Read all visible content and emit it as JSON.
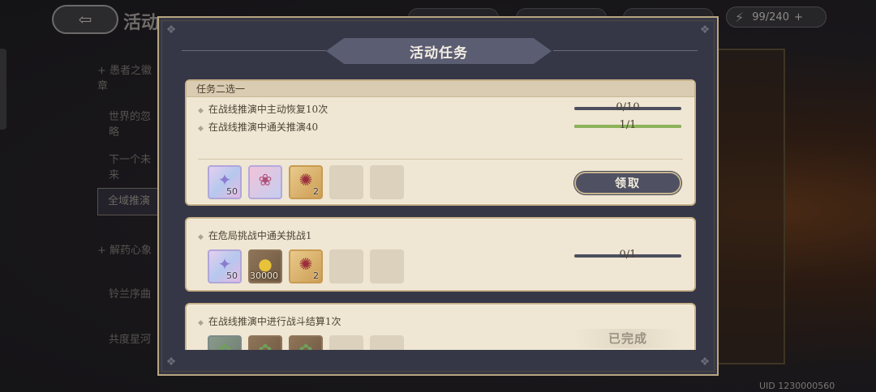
{
  "background": {
    "title": "活动",
    "energy": "99/240",
    "energy_plus": "+",
    "sidebar": [
      "+ 愚者之徽章",
      "世界的忽略",
      "下一个未来",
      "全域推演",
      "+ 解药心象",
      "铃兰序曲",
      "共度星河"
    ],
    "active_sidebar_index": 3,
    "uid": "UID 1230000560"
  },
  "dialog": {
    "title": "活动任务",
    "cards": [
      {
        "header": "任务二选一",
        "tasks": [
          {
            "label": "在战线推演中主动恢复10次",
            "progress_text": "0/10",
            "progress": 0.0
          },
          {
            "label": "在战线推演中通关推演40",
            "progress_text": "1/1",
            "progress": 1.0
          }
        ],
        "rewards": [
          {
            "icon": "star-shard-icon",
            "count": "50",
            "style": "purple"
          },
          {
            "icon": "pink-creature-icon",
            "count": "",
            "style": "pink"
          },
          {
            "icon": "red-crab-icon",
            "count": "2",
            "style": "gold"
          }
        ],
        "action": "领取"
      },
      {
        "header": "",
        "tasks": [
          {
            "label": "在危局挑战中通关挑战1",
            "progress_text": "0/1",
            "progress": 0.0
          }
        ],
        "rewards": [
          {
            "icon": "star-shard-icon",
            "count": "50",
            "style": "purple"
          },
          {
            "icon": "gold-coin-icon",
            "count": "30000",
            "style": "bronze"
          },
          {
            "icon": "red-crab-icon",
            "count": "2",
            "style": "gold"
          }
        ],
        "action": ""
      },
      {
        "header": "",
        "tasks": [
          {
            "label": "在战线推演中进行战斗结算1次",
            "progress_text": "",
            "progress": null
          }
        ],
        "rewards": [
          {
            "icon": "green-item-icon",
            "count": "",
            "style": "bronze"
          },
          {
            "icon": "green-item-icon",
            "count": "",
            "style": "bronze"
          },
          {
            "icon": "green-item-icon",
            "count": "",
            "style": "bronze"
          }
        ],
        "action": "已完成"
      }
    ]
  },
  "colors": {
    "dialog_bg": "#363746",
    "card_bg": "#efe6d3",
    "frame_gold": "#b8a581",
    "progress_fill": "#8db35a",
    "progress_track": "#4d4f5e"
  }
}
